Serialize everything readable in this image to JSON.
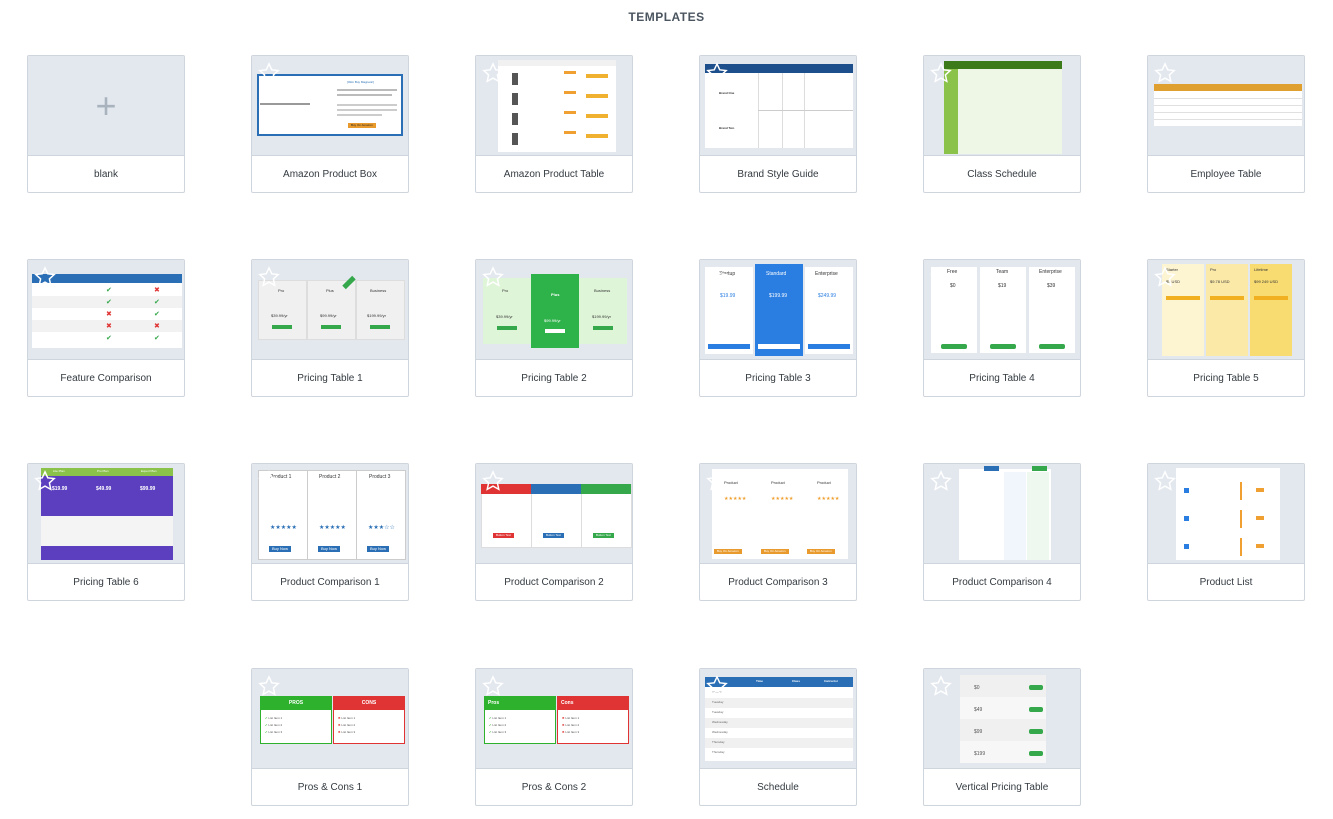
{
  "page": {
    "heading": "TEMPLATES"
  },
  "colors": {
    "accent_blue": "#2a6fb5",
    "green": "#34a84b",
    "red": "#e03434",
    "orange": "#e89a2c",
    "purple": "#5b3fbf",
    "lime": "#8bc34a"
  },
  "blank": {
    "plus": "+"
  },
  "templates": [
    {
      "label": "blank"
    },
    {
      "label": "Amazon Product Box"
    },
    {
      "label": "Amazon Product Table"
    },
    {
      "label": "Brand Style Guide"
    },
    {
      "label": "Class Schedule"
    },
    {
      "label": "Employee Table"
    },
    {
      "label": "Feature Comparison"
    },
    {
      "label": "Pricing Table 1"
    },
    {
      "label": "Pricing Table 2"
    },
    {
      "label": "Pricing Table 3"
    },
    {
      "label": "Pricing Table 4"
    },
    {
      "label": "Pricing Table 5"
    },
    {
      "label": "Pricing Table 6"
    },
    {
      "label": "Product Comparison 1"
    },
    {
      "label": "Product Comparison 2"
    },
    {
      "label": "Product Comparison 3"
    },
    {
      "label": "Product Comparison 4"
    },
    {
      "label": "Product List"
    },
    {
      "label": "Pros & Cons 1"
    },
    {
      "label": "Pros & Cons 2"
    },
    {
      "label": "Schedule"
    },
    {
      "label": "Vertical Pricing Table"
    }
  ],
  "thumbs": {
    "amazon_box": {
      "title": "[Okin Buy Magnetic]",
      "button": "Buy On Amazon"
    },
    "brand": {
      "row1": "Brand One",
      "row2": "Brand Two"
    },
    "pricing1": {
      "plans": [
        "Pro",
        "Plus",
        "Business"
      ],
      "prices": [
        "$39.99/yr",
        "$99.99/yr",
        "$199.99/yr"
      ]
    },
    "pricing2": {
      "plans": [
        "Pro",
        "Plus",
        "Business"
      ],
      "prices": [
        "$39.99/yr",
        "$99.99/yr",
        "$199.99/yr"
      ]
    },
    "pricing3": {
      "plans": [
        "Startup",
        "Standard",
        "Enterprise"
      ],
      "prices": [
        "$19.99",
        "$199.99",
        "$249.99"
      ]
    },
    "pricing4": {
      "plans": [
        "Free",
        "Team",
        "Enterprise"
      ],
      "prices": [
        "$0",
        "$19",
        "$39"
      ]
    },
    "pricing5": {
      "plans": [
        "Starter",
        "Pro",
        "Lifetime"
      ],
      "prices": [
        "$5 USD",
        "$9.78 USD",
        "$99 249 USD"
      ]
    },
    "pricing6": {
      "plans": [
        "Lite Plan",
        "Pro Plan",
        "Expert Plan"
      ],
      "prices": [
        "$19.99",
        "$49.99",
        "$99.99"
      ]
    },
    "pc1": {
      "products": [
        "Product 1",
        "Product 2",
        "Product 3"
      ],
      "button": "Buy Now"
    },
    "pc2": {
      "button": "Button Text"
    },
    "pc3": {
      "col": "Product",
      "button": "Buy On Amazon"
    },
    "pros1": {
      "pros": "PROS",
      "cons": "CONS",
      "items": [
        "List Item 1",
        "List Item 2",
        "List Item 3"
      ]
    },
    "pros2": {
      "pros": "Pros",
      "cons": "Cons",
      "items": [
        "List Item 1",
        "List Item 2",
        "List Item 3"
      ]
    },
    "schedule": {
      "cols": [
        "Time",
        "Class",
        "Instructor"
      ],
      "days": [
        "Monday",
        "Tuesday",
        "Tuesday",
        "Wednesday",
        "Wednesday",
        "Thursday",
        "Thursday",
        "Friday"
      ]
    },
    "vertical": {
      "prices": [
        "$0",
        "$49",
        "$99",
        "$199"
      ]
    }
  }
}
